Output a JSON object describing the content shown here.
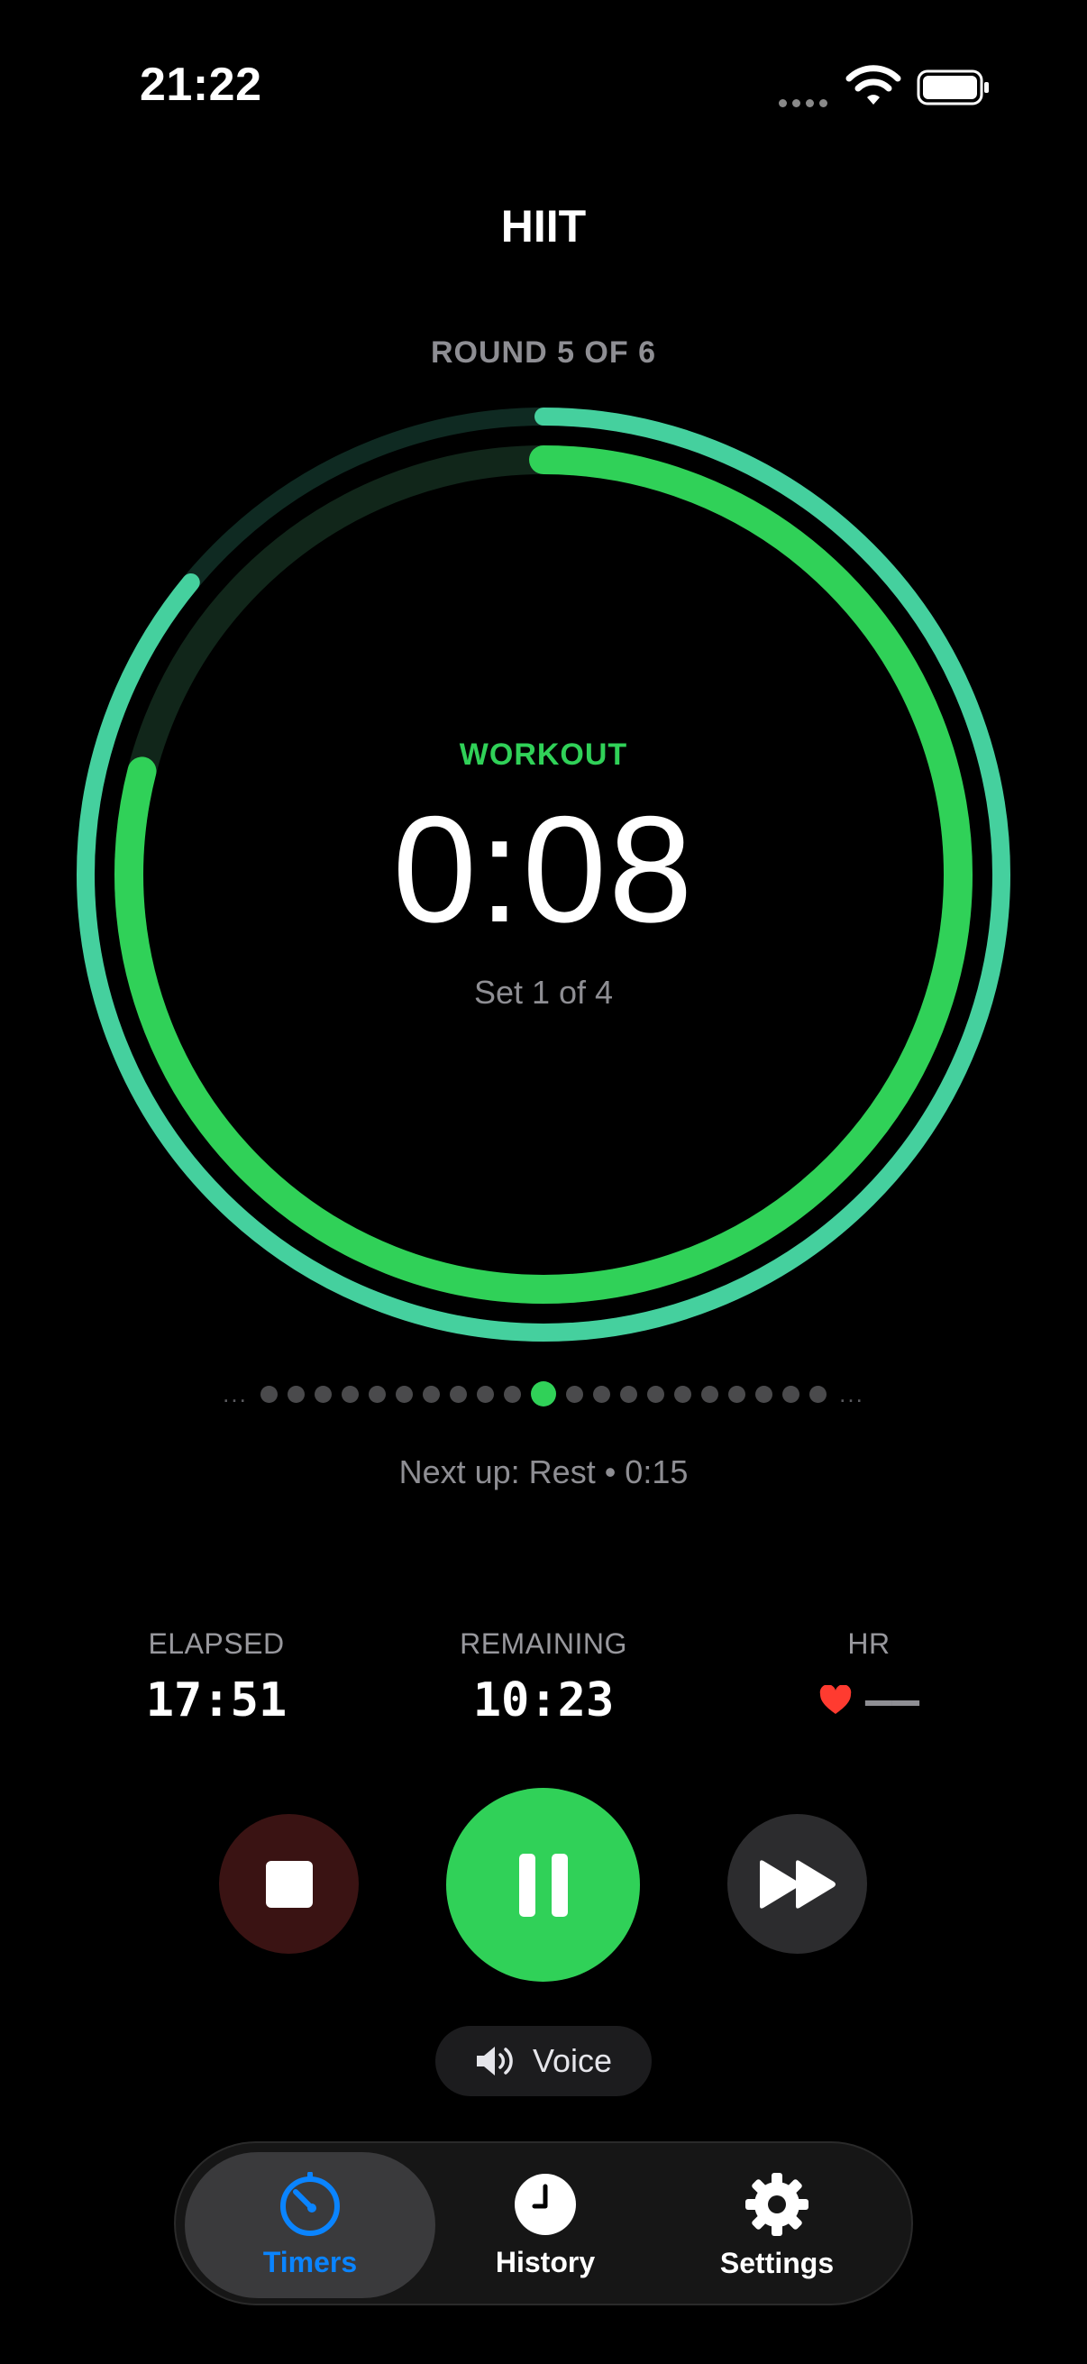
{
  "status_bar": {
    "time": "21:22"
  },
  "header": {
    "title": "HIIT",
    "round_label": "ROUND 5 OF 6"
  },
  "rings": {
    "outer_progress": 0.86,
    "inner_progress": 0.79,
    "outer_color": "#45d09e",
    "inner_color": "#30d158",
    "outer_track_color": "#0f2a22",
    "inner_track_color": "#11261a"
  },
  "timer": {
    "phase": "WORKOUT",
    "time": "0:08",
    "set_label": "Set 1 of 4"
  },
  "progress_dots": {
    "total": 21,
    "active_index": 10,
    "leading_ellipsis": "...",
    "trailing_ellipsis": "..."
  },
  "next_up": "Next up: Rest • 0:15",
  "stats": {
    "elapsed_label": "ELAPSED",
    "elapsed_value": "17:51",
    "remaining_label": "REMAINING",
    "remaining_value": "10:23",
    "hr_label": "HR",
    "hr_value": "——"
  },
  "controls": {
    "stop_icon": "stop-icon",
    "pause_icon": "pause-icon",
    "skip_icon": "fast-forward-icon"
  },
  "voice": {
    "label": "Voice",
    "icon": "speaker-icon"
  },
  "tabbar": {
    "tabs": [
      {
        "label": "Timers",
        "icon": "timer-icon",
        "active": true
      },
      {
        "label": "History",
        "icon": "clock-icon",
        "active": false
      },
      {
        "label": "Settings",
        "icon": "gear-icon",
        "active": false
      }
    ]
  },
  "colors": {
    "accent": "#30d158",
    "tab_active": "#0a84ff",
    "heart": "#ff3b30"
  }
}
